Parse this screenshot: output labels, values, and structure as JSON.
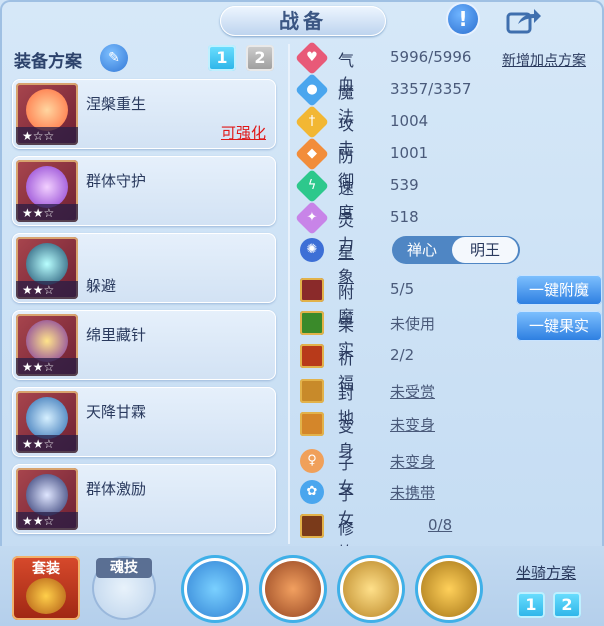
{
  "header": {
    "title": "战备",
    "help_glyph": "!"
  },
  "left": {
    "plan_title": "装备方案",
    "plan_buttons": [
      "1",
      "2"
    ],
    "equipment": [
      {
        "name": "涅槃重生",
        "stars": "★☆☆",
        "extra": "可强化",
        "color": "#ff6a3c"
      },
      {
        "name": "群体守护",
        "stars": "★★☆",
        "extra": "",
        "color": "#b56cff"
      },
      {
        "name": "躲避",
        "stars": "★★☆",
        "extra": "",
        "color": "#28d8d8"
      },
      {
        "name": "绵里藏针",
        "stars": "★★☆",
        "extra": "",
        "color": "#f3c23a"
      },
      {
        "name": "天降甘霖",
        "stars": "★★☆",
        "extra": "",
        "color": "#5fb8ff"
      },
      {
        "name": "群体激励",
        "stars": "★★☆",
        "extra": "",
        "color": "#7a8cff"
      }
    ]
  },
  "stats": {
    "hp": {
      "label": "气血",
      "value": "5996/5996",
      "color": "#e85a78",
      "icon": "heart-icon"
    },
    "mp": {
      "label": "魔法",
      "value": "3357/3357",
      "color": "#4aa6ee",
      "icon": "drop-icon"
    },
    "atk": {
      "label": "攻击",
      "value": "1004",
      "color": "#f2b733",
      "icon": "sword-icon"
    },
    "def": {
      "label": "防御",
      "value": "1001",
      "color": "#f28d3a",
      "icon": "shield-icon"
    },
    "spd": {
      "label": "速度",
      "value": "539",
      "color": "#2dc88c",
      "icon": "bolt-icon"
    },
    "spi": {
      "label": "灵力",
      "value": "518",
      "color": "#c884e8",
      "icon": "spirit-icon"
    }
  },
  "add_points": "新增加点方案",
  "star": {
    "label": "星象",
    "options": [
      "禅心",
      "明王"
    ],
    "selected": "明王"
  },
  "features": [
    {
      "label": "附魔",
      "value": "5/5",
      "green": true
    },
    {
      "label": "果实",
      "value": "未使用",
      "green": false
    },
    {
      "label": "祈福",
      "value": "2/2",
      "green": true
    },
    {
      "label": "封地",
      "value": "未受赏",
      "green": false
    },
    {
      "label": "变身",
      "value": "未变身",
      "green": false
    },
    {
      "label": "子女",
      "value": "未变身",
      "green": false
    },
    {
      "label": "子女",
      "value": "未携带",
      "green": false
    },
    {
      "label": "修炼觉醒",
      "value": "0/8",
      "green": false
    }
  ],
  "actions": {
    "enchant": "一键附魔",
    "fruit": "一键果实"
  },
  "bottom": {
    "suit": "套装",
    "soul_skill": "魂技",
    "mount_title": "坐骑方案",
    "mount_buttons": [
      "1",
      "2"
    ]
  }
}
